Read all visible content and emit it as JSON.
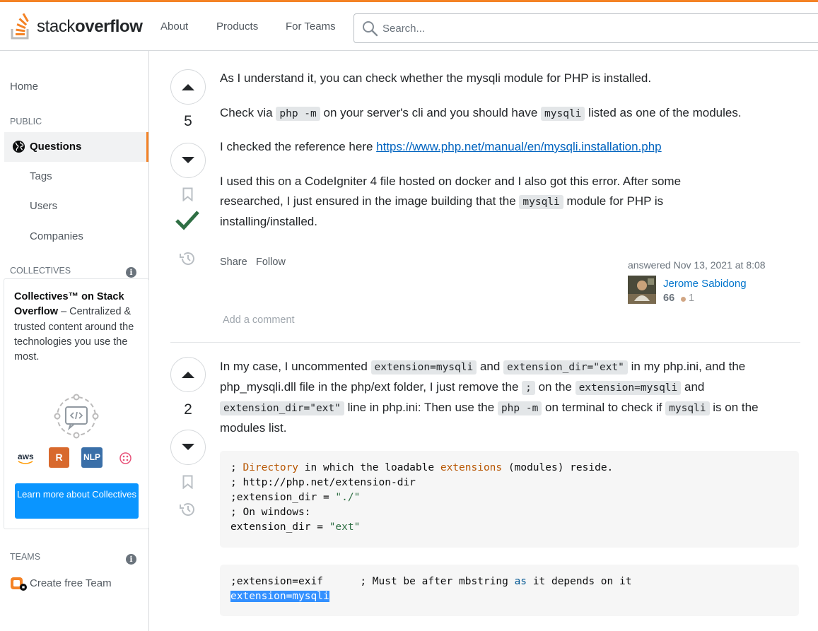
{
  "brand": {
    "name_light": "stack",
    "name_bold": "overflow",
    "accent": "#f48225",
    "link": "#0063bf"
  },
  "nav": {
    "about": "About",
    "products": "Products",
    "for_teams": "For Teams"
  },
  "search": {
    "placeholder": "Search..."
  },
  "sidebar": {
    "home": "Home",
    "public_heading": "PUBLIC",
    "questions": "Questions",
    "tags": "Tags",
    "users": "Users",
    "companies": "Companies",
    "collectives_heading": "COLLECTIVES",
    "collectives_title": "Collectives™ on Stack Overflow",
    "collectives_desc": " – Centralized & trusted content around the technologies you use the most.",
    "collective_badges": {
      "aws": "aws",
      "r": "R",
      "nlp": "NLP"
    },
    "learn_more": "Learn more about Collectives",
    "teams_heading": "TEAMS",
    "create_team": "Create free Team"
  },
  "answers": [
    {
      "score": "5",
      "accepted": true,
      "p1": "As I understand it, you can check whether the mysqli module for PHP is installed.",
      "p2_pre": "Check via ",
      "p2_code": "php -m",
      "p2_mid": " on your server's cli and you should have ",
      "p2_code2": "mysqli",
      "p2_post": " listed as one of the modules.",
      "p3_pre": "I checked the reference here ",
      "p3_link": "https://www.php.net/manual/en/mysqli.installation.php",
      "p4_pre": "I used this on a CodeIgniter 4 file hosted on docker and I also got this error. After some researched, I just ensured in the image building that the ",
      "p4_code": "mysqli",
      "p4_post": " module for PHP is installing/installed.",
      "share": "Share",
      "follow": "Follow",
      "answered": "answered Nov 13, 2021 at 8:08",
      "user_name": "Jerome Sabidong",
      "user_rep": "66",
      "user_bronze": "1",
      "add_comment": "Add a comment"
    },
    {
      "score": "2",
      "t1": "In my case, I uncommented ",
      "c1": "extension=mysqli",
      "t2": " and ",
      "c2": "extension_dir=\"ext\"",
      "t3": " in my php.ini, and the php_mysqli.dll file in the php/ext folder, I just remove the ",
      "c3": ";",
      "t4": " on the ",
      "c4": "extension=mysqli",
      "t5": " and ",
      "c5": "extension_dir=\"ext\"",
      "t6": " line in php.ini: Then use the ",
      "c6": "php -m",
      "t7": " on terminal to check if ",
      "c7": "mysqli",
      "t8": " is on the modules list.",
      "code1": {
        "l1a": "; ",
        "l1b": "Directory",
        "l1c": " in which the loadable ",
        "l1d": "extensions",
        "l1e": " (modules) reside.",
        "l2": "; http://php.net/extension-dir",
        "l3a": ";extension_dir = ",
        "l3b": "\"./\"",
        "l4": "; On windows:",
        "l5a": "extension_dir = ",
        "l5b": "\"ext\""
      },
      "code2": {
        "l1a": ";extension=exif      ; Must be after mbstring ",
        "l1b": "as",
        "l1c": " it depends on it",
        "l2": "extension=mysqli"
      }
    }
  ]
}
